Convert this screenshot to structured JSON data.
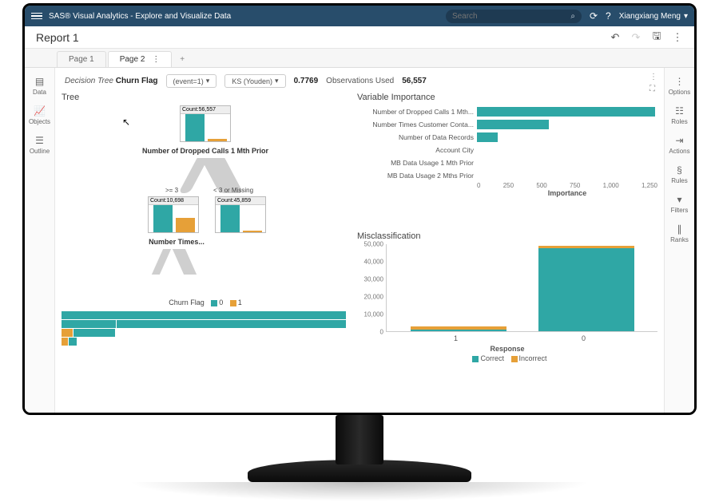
{
  "appbar": {
    "title": "SAS® Visual Analytics - Explore and Visualize Data",
    "search_placeholder": "Search",
    "user": "Xiangxiang Meng"
  },
  "toolbar": {
    "report_title": "Report 1"
  },
  "tabs": {
    "page1": "Page 1",
    "page2": "Page 2"
  },
  "leftnav": {
    "data": "Data",
    "objects": "Objects",
    "outline": "Outline"
  },
  "rightnav": {
    "options": "Options",
    "roles": "Roles",
    "actions": "Actions",
    "rules": "Rules",
    "filters": "Filters",
    "ranks": "Ranks"
  },
  "model_head": {
    "type_label": "Decision Tree",
    "target": "Churn Flag",
    "event_btn": "(event=1)",
    "ks_btn": "KS (Youden)",
    "ks_value": "0.7769",
    "obs_label": "Observations Used",
    "obs_value": "56,557"
  },
  "tree": {
    "section": "Tree",
    "root_count": "Count:56,557",
    "root_split": "Number of Dropped Calls 1 Mth Prior",
    "left_rule": ">= 3",
    "right_rule": "< 3 or Missing",
    "left_count": "Count:10,698",
    "right_count": "Count:45,859",
    "left_split": "Number Times...",
    "legend_target": "Churn Flag",
    "legend0": "0",
    "legend1": "1"
  },
  "var_importance": {
    "section": "Variable Importance",
    "axis_label": "Importance",
    "ticks": [
      "0",
      "250",
      "500",
      "750",
      "1,000",
      "1,250"
    ],
    "items": [
      {
        "label": "Number of Dropped Calls 1 Mth...",
        "value": 1380
      },
      {
        "label": "Number Times Customer Conta...",
        "value": 560
      },
      {
        "label": "Number of Data Records",
        "value": 160
      },
      {
        "label": "Account City",
        "value": 0
      },
      {
        "label": "MB Data Usage 1 Mth Prior",
        "value": 0
      },
      {
        "label": "MB Data Usage 2 Mths Prior",
        "value": 0
      }
    ],
    "max": 1400
  },
  "misclass": {
    "section": "Misclassification",
    "ylabels": [
      "50,000",
      "40,000",
      "30,000",
      "20,000",
      "10,000",
      "0"
    ],
    "axis_label": "Response",
    "legend_correct": "Correct",
    "legend_incorrect": "Incorrect",
    "resp1_label": "1",
    "resp0_label": "0",
    "resp1": {
      "correct": 1200,
      "incorrect": 1600
    },
    "resp0": {
      "correct": 52000,
      "incorrect": 1500
    },
    "ymax": 55000
  },
  "chart_data": [
    {
      "type": "bar",
      "orientation": "horizontal",
      "title": "Variable Importance",
      "xlabel": "Importance",
      "ylabel": "",
      "xlim": [
        0,
        1400
      ],
      "categories": [
        "Number of Dropped Calls 1 Mth Prior",
        "Number Times Customer Contacted",
        "Number of Data Records",
        "Account City",
        "MB Data Usage 1 Mth Prior",
        "MB Data Usage 2 Mths Prior"
      ],
      "values": [
        1380,
        560,
        160,
        0,
        0,
        0
      ]
    },
    {
      "type": "bar",
      "stacked": true,
      "title": "Misclassification",
      "xlabel": "Response",
      "ylabel": "",
      "ylim": [
        0,
        55000
      ],
      "categories": [
        "1",
        "0"
      ],
      "series": [
        {
          "name": "Correct",
          "values": [
            1200,
            52000
          ]
        },
        {
          "name": "Incorrect",
          "values": [
            1600,
            1500
          ]
        }
      ]
    },
    {
      "type": "tree",
      "title": "Decision Tree — Churn Flag",
      "root": {
        "count": 56557,
        "split": "Number of Dropped Calls 1 Mth Prior",
        "children": [
          {
            "rule": ">= 3",
            "count": 10698,
            "split": "Number Times Customer Contacted"
          },
          {
            "rule": "< 3 or Missing",
            "count": 45859
          }
        ]
      }
    }
  ]
}
